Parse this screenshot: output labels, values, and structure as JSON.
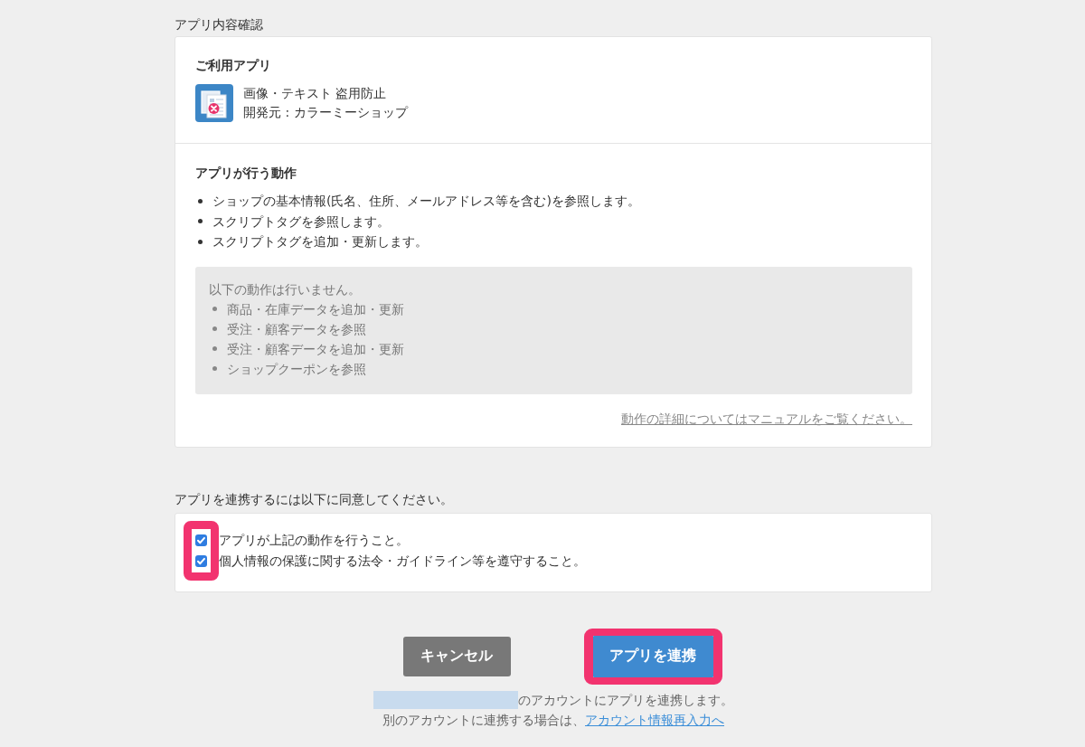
{
  "review": {
    "title": "アプリ内容確認",
    "app": {
      "heading": "ご利用アプリ",
      "name": "画像・テキスト 盗用防止",
      "developer": "開発元 : カラーミーショップ"
    },
    "actions": {
      "heading": "アプリが行う動作",
      "items": [
        "ショップの基本情報(氏名、住所、メールアドレス等を含む)を参照します。",
        "スクリプトタグを参照します。",
        "スクリプトタグを追加・更新します。"
      ],
      "restrictions": {
        "title": "以下の動作は行いません。",
        "items": [
          "商品・在庫データを追加・更新",
          "受注・顧客データを参照",
          "受注・顧客データを追加・更新",
          "ショップクーポンを参照"
        ]
      },
      "manual_link": "動作の詳細についてはマニュアルをご覧ください。"
    }
  },
  "consent": {
    "title": "アプリを連携するには以下に同意してください。",
    "highlighted": true,
    "items": [
      {
        "label": "アプリが上記の動作を行うこと。",
        "checked": true
      },
      {
        "label": "個人情報の保護に関する法令・ガイドライン等を遵守すること。",
        "checked": true
      }
    ]
  },
  "buttons": [
    {
      "label": "キャンセル",
      "kind": "cancel",
      "highlighted": false
    },
    {
      "label": "アプリを連携",
      "kind": "submit",
      "highlighted": true
    }
  ],
  "account_note": {
    "text": "のアカウントにアプリを連携します。",
    "switch_text": "別のアカウントに連携する場合は、",
    "link": "アカウント情報再入力へ"
  }
}
